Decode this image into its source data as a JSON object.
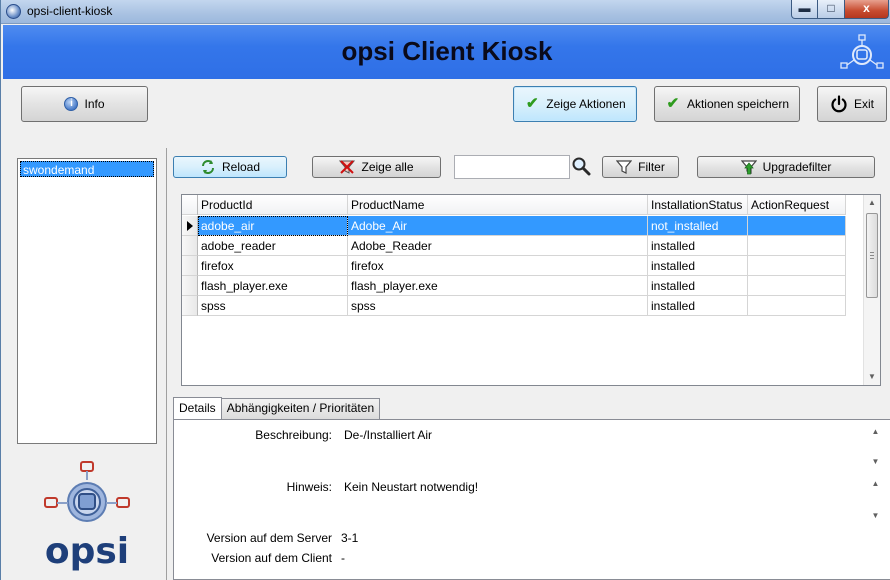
{
  "window": {
    "title": "opsi-client-kiosk",
    "close_glyph": "x"
  },
  "header": {
    "title": "opsi Client Kiosk"
  },
  "toolbar": {
    "info_label": "Info",
    "show_actions_label": "Zeige Aktionen",
    "save_actions_label": "Aktionen speichern",
    "exit_label": "Exit"
  },
  "clients": [
    "swondemand"
  ],
  "logo": {
    "text": "opsi"
  },
  "filterbar": {
    "reload_label": "Reload",
    "show_all_label": "Zeige alle",
    "search_value": "",
    "filter_label": "Filter",
    "upgradefilter_label": "Upgradefilter"
  },
  "table": {
    "columns": [
      "ProductId",
      "ProductName",
      "InstallationStatus",
      "ActionRequest"
    ],
    "rows": [
      {
        "id": "adobe_air",
        "name": "Adobe_Air",
        "status": "not_installed",
        "action": ""
      },
      {
        "id": "adobe_reader",
        "name": "Adobe_Reader",
        "status": "installed",
        "action": ""
      },
      {
        "id": "firefox",
        "name": "firefox",
        "status": "installed",
        "action": ""
      },
      {
        "id": "flash_player.exe",
        "name": "flash_player.exe",
        "status": "installed",
        "action": ""
      },
      {
        "id": "spss",
        "name": "spss",
        "status": "installed",
        "action": ""
      }
    ],
    "selected_index": 0
  },
  "tabs": [
    "Details",
    "Abhängigkeiten / Prioritäten"
  ],
  "details": {
    "description_label": "Beschreibung:",
    "description_value": "De-/Installiert Air",
    "hint_label": "Hinweis:",
    "hint_value": "Kein Neustart notwendig!",
    "server_version_label": "Version auf dem Server",
    "server_version_value": "3-1",
    "client_version_label": "Version auf dem Client",
    "client_version_value": "-"
  },
  "colors": {
    "header_blue": "#3476ea",
    "selection_blue": "#3399ff",
    "check_green": "#2e9b1e"
  }
}
